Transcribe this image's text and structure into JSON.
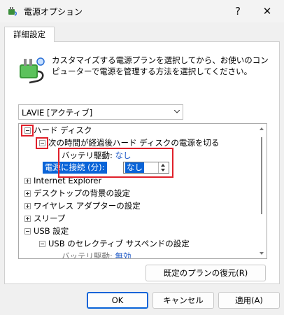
{
  "window": {
    "title": "電源オプション",
    "help_label": "?",
    "close_label": "✕"
  },
  "tab": {
    "label": "詳細設定"
  },
  "description": "カスタマイズする電源プランを選択してから、お使いのコンピューターで電源を管理する方法を選択してください。",
  "plan_select": {
    "value": "LAVIE [アクティブ]"
  },
  "tree": {
    "items": [
      {
        "label": "ハード ディスク",
        "state": "expanded"
      },
      {
        "label": "次の時間が経過後ハード ディスクの電源を切る",
        "state": "expanded"
      },
      {
        "label": "バッテリ駆動:",
        "value": "なし"
      },
      {
        "label": "電源に接続 (分):",
        "value": "なし"
      },
      {
        "label": "Internet Explorer",
        "state": "collapsed"
      },
      {
        "label": "デスクトップの背景の設定",
        "state": "collapsed"
      },
      {
        "label": "ワイヤレス アダプターの設定",
        "state": "collapsed"
      },
      {
        "label": "スリープ",
        "state": "collapsed"
      },
      {
        "label": "USB 設定",
        "state": "expanded"
      },
      {
        "label": "USB のセレクティブ サスペンドの設定",
        "state": "expanded"
      },
      {
        "label": "バッテリ駆動:",
        "value": "無効"
      }
    ]
  },
  "buttons": {
    "restore": "既定のプランの復元(R)",
    "ok": "OK",
    "cancel": "キャンセル",
    "apply": "適用(A)"
  },
  "colors": {
    "highlight": "#0a64d8",
    "annotation": "#e0202a",
    "value_text": "#1a56c6"
  }
}
